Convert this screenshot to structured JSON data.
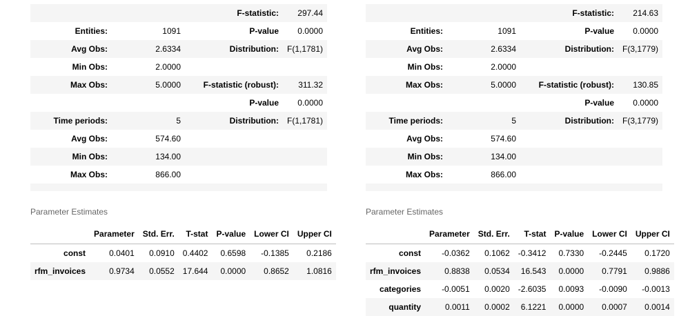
{
  "left": {
    "summary_rows": [
      [
        "",
        "",
        "F-statistic:",
        "297.44"
      ],
      [
        "Entities:",
        "1091",
        "P-value",
        "0.0000"
      ],
      [
        "Avg Obs:",
        "2.6334",
        "Distribution:",
        "F(1,1781)"
      ],
      [
        "Min Obs:",
        "2.0000",
        "",
        ""
      ],
      [
        "Max Obs:",
        "5.0000",
        "F-statistic (robust):",
        "311.32"
      ],
      [
        "",
        "",
        "P-value",
        "0.0000"
      ],
      [
        "Time periods:",
        "5",
        "Distribution:",
        "F(1,1781)"
      ],
      [
        "Avg Obs:",
        "574.60",
        "",
        ""
      ],
      [
        "Min Obs:",
        "134.00",
        "",
        ""
      ],
      [
        "Max Obs:",
        "866.00",
        "",
        ""
      ]
    ],
    "param_caption": "Parameter Estimates",
    "param_headers": [
      "",
      "Parameter",
      "Std. Err.",
      "T-stat",
      "P-value",
      "Lower CI",
      "Upper CI"
    ],
    "param_rows": [
      [
        "const",
        "0.0401",
        "0.0910",
        "0.4402",
        "0.6598",
        "-0.1385",
        "0.2186"
      ],
      [
        "rfm_invoices",
        "0.9734",
        "0.0552",
        "17.644",
        "0.0000",
        "0.8652",
        "1.0816"
      ]
    ]
  },
  "right": {
    "summary_rows": [
      [
        "",
        "",
        "F-statistic:",
        "214.63"
      ],
      [
        "Entities:",
        "1091",
        "P-value",
        "0.0000"
      ],
      [
        "Avg Obs:",
        "2.6334",
        "Distribution:",
        "F(3,1779)"
      ],
      [
        "Min Obs:",
        "2.0000",
        "",
        ""
      ],
      [
        "Max Obs:",
        "5.0000",
        "F-statistic (robust):",
        "130.85"
      ],
      [
        "",
        "",
        "P-value",
        "0.0000"
      ],
      [
        "Time periods:",
        "5",
        "Distribution:",
        "F(3,1779)"
      ],
      [
        "Avg Obs:",
        "574.60",
        "",
        ""
      ],
      [
        "Min Obs:",
        "134.00",
        "",
        ""
      ],
      [
        "Max Obs:",
        "866.00",
        "",
        ""
      ]
    ],
    "param_caption": "Parameter Estimates",
    "param_headers": [
      "",
      "Parameter",
      "Std. Err.",
      "T-stat",
      "P-value",
      "Lower CI",
      "Upper CI"
    ],
    "param_rows": [
      [
        "const",
        "-0.0362",
        "0.1062",
        "-0.3412",
        "0.7330",
        "-0.2445",
        "0.1720"
      ],
      [
        "rfm_invoices",
        "0.8838",
        "0.0534",
        "16.543",
        "0.0000",
        "0.7791",
        "0.9886"
      ],
      [
        "categories",
        "-0.0051",
        "0.0020",
        "-2.6035",
        "0.0093",
        "-0.0090",
        "-0.0013"
      ],
      [
        "quantity",
        "0.0011",
        "0.0002",
        "6.1221",
        "0.0000",
        "0.0007",
        "0.0014"
      ]
    ]
  }
}
